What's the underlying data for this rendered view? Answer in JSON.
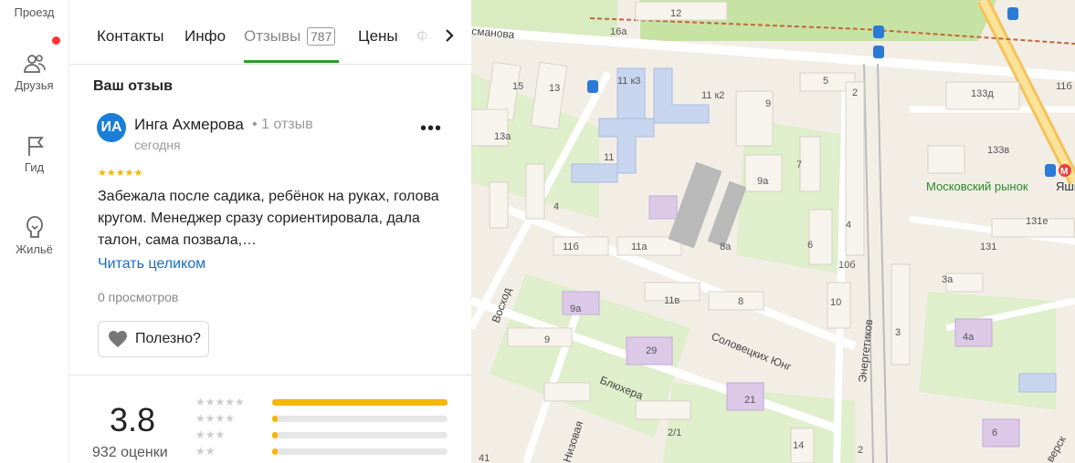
{
  "rail": {
    "items": [
      {
        "label": "Проезд",
        "icon": "car-icon"
      },
      {
        "label": "Друзья",
        "icon": "friends-icon"
      },
      {
        "label": "Гид",
        "icon": "flag-icon"
      },
      {
        "label": "Жильё",
        "icon": "house-icon"
      }
    ]
  },
  "tabs": [
    {
      "label": "Контакты"
    },
    {
      "label": "Инфо"
    },
    {
      "label": "Отзывы",
      "count": "787"
    },
    {
      "label": "Цены"
    },
    {
      "label": "Ф"
    }
  ],
  "review": {
    "section_title": "Ваш отзыв",
    "avatar_initials": "ИА",
    "author": "Инга Ахмерова",
    "author_reviews": "• 1 отзыв",
    "date": "сегодня",
    "stars": "★★★★★",
    "text": "Забежала после садика, ребёнок на руках, голова кругом. Менеджер сразу сориентировала, дала талон, сама позвала,…",
    "read_more": "Читать целиком",
    "views": "0 просмотров",
    "useful": "Полезно?"
  },
  "rating": {
    "value": "3.8",
    "count": "932 оценки",
    "distribution": [
      {
        "stars": "★★★★★",
        "share": 1.0
      },
      {
        "stars": "★★★★",
        "share": 0.03
      },
      {
        "stars": "★★★",
        "share": 0.03
      },
      {
        "stars": "★★",
        "share": 0.03
      }
    ]
  },
  "map": {
    "streets": [
      "Соловецких Юнг",
      "Блюхера",
      "Энергетиков",
      "Восход",
      "сманова",
      "Низовая",
      "верск"
    ],
    "poi": "Московский рынок",
    "poi_metro": "Яшь",
    "buildings": [
      "12",
      "16a",
      "15",
      "13",
      "13а",
      "11 к3",
      "11 к2",
      "9",
      "5",
      "2",
      "133д",
      "11б",
      "133в",
      "131е",
      "131",
      "11",
      "9а",
      "7",
      "4",
      "6",
      "10б",
      "8а",
      "11а",
      "11б",
      "4",
      "3а",
      "8",
      "11в",
      "10",
      "9а",
      "3",
      "4а",
      "9",
      "29",
      "21",
      "6",
      "2/1",
      "14",
      "41",
      "2"
    ],
    "colors": {
      "park": "#c7e3a3",
      "road": "#ffffff",
      "highway": "#f5c25b",
      "building": "#f7f4ee",
      "school": "#c8d5ef",
      "kindergarten": "#dcc9e8"
    }
  }
}
